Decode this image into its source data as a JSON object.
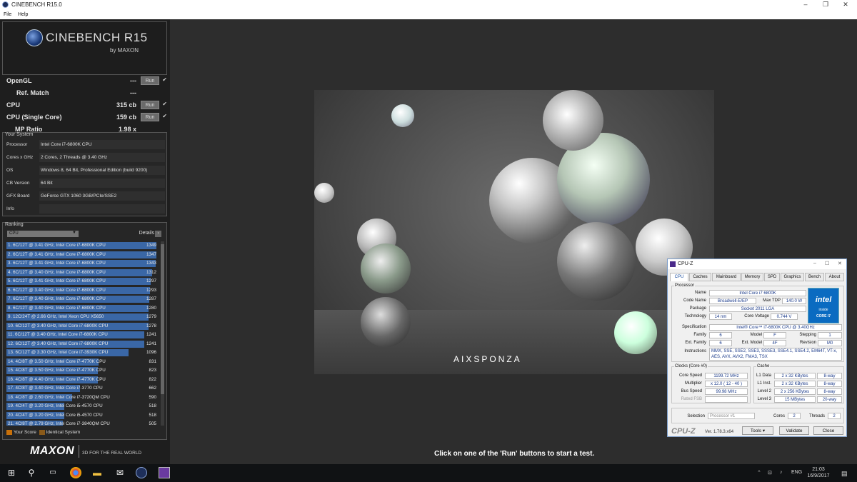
{
  "window": {
    "title": "CINEBENCH R15.0"
  },
  "menu": [
    "File",
    "Help"
  ],
  "logo": {
    "name": "CINEBENCH R15",
    "by": "by MAXON"
  },
  "scores": [
    {
      "label": "OpenGL",
      "value": "---",
      "run": "Run",
      "check": true
    },
    {
      "label": "Ref. Match",
      "value": "---",
      "run": "",
      "check": false
    },
    {
      "label": "CPU",
      "value": "315 cb",
      "run": "Run",
      "check": true
    },
    {
      "label": "CPU (Single Core)",
      "value": "159 cb",
      "run": "Run",
      "check": true
    },
    {
      "label": "MP Ratio",
      "value": "1.98 x",
      "run": "",
      "check": false
    }
  ],
  "system": {
    "title": "Your System",
    "rows": [
      {
        "k": "Processor",
        "v": "Intel Core i7-6800K CPU"
      },
      {
        "k": "Cores x GHz",
        "v": "2 Cores, 2 Threads @ 3.40 GHz"
      },
      {
        "k": "OS",
        "v": "Windows 8, 64 Bit, Professional Edition (build 9200)"
      },
      {
        "k": "CB Version",
        "v": "64 Bit"
      },
      {
        "k": "GFX Board",
        "v": "GeForce GTX 1060 3GB/PCIe/SSE2"
      },
      {
        "k": "Info",
        "v": ""
      }
    ]
  },
  "ranking": {
    "title": "Ranking",
    "dropdown": "CPU",
    "details": "Details",
    "items": [
      {
        "t": "1. 6C/12T @ 3.41 GHz, Intel Core i7-6800K CPU",
        "s": "1349"
      },
      {
        "t": "2. 6C/12T @ 3.41 GHz, Intel Core i7-6800K CPU",
        "s": "1347"
      },
      {
        "t": "3. 6C/12T @ 3.41 GHz, Intel Core i7-6800K CPU",
        "s": "1343"
      },
      {
        "t": "4. 6C/12T @ 3.40 GHz, Intel Core i7-6800K CPU",
        "s": "1312"
      },
      {
        "t": "5. 6C/12T @ 3.41 GHz, Intel Core i7-6800K CPU",
        "s": "1297"
      },
      {
        "t": "6. 6C/12T @ 3.40 GHz, Intel Core i7-6800K CPU",
        "s": "1293"
      },
      {
        "t": "7. 6C/12T @ 3.40 GHz, Intel Core i7-6800K CPU",
        "s": "1287"
      },
      {
        "t": "8. 6C/12T @ 3.40 GHz, Intel Core i7-6800K CPU",
        "s": "1280"
      },
      {
        "t": "9. 12C/24T @ 2.66 GHz, Intel Xeon CPU X5650",
        "s": "1279"
      },
      {
        "t": "10. 6C/12T @ 3.40 GHz, Intel Core i7-6800K CPU",
        "s": "1278"
      },
      {
        "t": "11. 6C/12T @ 3.40 GHz, Intel Core i7-6800K CPU",
        "s": "1241"
      },
      {
        "t": "12. 6C/12T @ 3.40 GHz, Intel Core i7-6800K CPU",
        "s": "1241"
      },
      {
        "t": "13. 6C/12T @ 3.30 GHz,  Intel Core i7-3930K CPU",
        "s": "1096"
      },
      {
        "t": "14. 4C/8T @ 3.50 GHz, Intel Core i7-4770K CPU",
        "s": "831"
      },
      {
        "t": "15. 4C/8T @ 3.50 GHz, Intel Core i7-4770K CPU",
        "s": "823"
      },
      {
        "t": "16. 4C/8T @ 4.40 GHz, Intel Core i7-4770K CPU",
        "s": "822"
      },
      {
        "t": "17. 4C/8T @ 3.40 GHz,  Intel Core i7-3770 CPU",
        "s": "662"
      },
      {
        "t": "18. 4C/8T @ 2.60 GHz, Intel Core i7-3720QM CPU",
        "s": "590"
      },
      {
        "t": "19. 4C/4T @ 3.20 GHz, Intel Core i5-4570 CPU",
        "s": "518"
      },
      {
        "t": "20. 4C/4T @ 3.20 GHz, Intel Core i5-4570 CPU",
        "s": "518"
      },
      {
        "t": "21. 4C/8T @ 2.79 GHz, Intel Core i7-3840QM CPU",
        "s": "505"
      }
    ],
    "legend": {
      "your_score": "Your Score",
      "identical": "Identical System"
    }
  },
  "footer": {
    "brand": "MAXON",
    "tagline": "3D FOR THE REAL WORLD"
  },
  "render": {
    "brand": "AIXSPONZA"
  },
  "status_text": "Click on one of the 'Run' buttons to start a test.",
  "cpuz": {
    "title": "CPU-Z",
    "tabs": [
      "CPU",
      "Caches",
      "Mainboard",
      "Memory",
      "SPD",
      "Graphics",
      "Bench",
      "About"
    ],
    "processor_title": "Processor",
    "name_k": "Name",
    "name": "Intel Core i7 6800K",
    "codename_k": "Code Name",
    "codename": "Broadwell-E/EP",
    "tdp_k": "Max TDP",
    "tdp": "140.0 W",
    "package_k": "Package",
    "package": "Socket 2011 LGA",
    "tech_k": "Technology",
    "tech": "14 nm",
    "voltage_k": "Core Voltage",
    "voltage": "0.744 V",
    "spec_k": "Specification",
    "spec": "Intel® Core™ i7-6800K CPU @ 3.40GHz",
    "family_k": "Family",
    "family": "6",
    "model_k": "Model",
    "model": "F",
    "stepping_k": "Stepping",
    "stepping": "1",
    "extfam_k": "Ext. Family",
    "extfam": "6",
    "extmodel_k": "Ext. Model",
    "extmodel": "4F",
    "revision_k": "Revision",
    "revision": "M0",
    "instr_k": "Instructions",
    "instr": "MMX, SSE, SSE2, SSE3, SSSE3, SSE4.1, SSE4.2, EM64T, VT-x, AES, AVX, AVX2, FMA3, TSX",
    "intel": {
      "logo": "intel",
      "inside": "inside",
      "core": "CORE i7"
    },
    "clocks_title": "Clocks (Core #0)",
    "corespeed_k": "Core Speed",
    "corespeed": "1199.72 MHz",
    "mult_k": "Multiplier",
    "mult": "x 12.0 ( 12 - 40 )",
    "bus_k": "Bus Speed",
    "bus": "99.98 MHz",
    "fsb_k": "Rated FSB",
    "fsb": "",
    "cache_title": "Cache",
    "l1d_k": "L1 Data",
    "l1d": "2 x 32 KBytes",
    "l1d_w": "8-way",
    "l1i_k": "L1 Inst.",
    "l1i": "2 x 32 KBytes",
    "l1i_w": "8-way",
    "l2_k": "Level 2",
    "l2": "2 x 256 KBytes",
    "l2_w": "8-way",
    "l3_k": "Level 3",
    "l3": "15 MBytes",
    "l3_w": "20-way",
    "selection_k": "Selection",
    "selection": "Processor #1",
    "cores_k": "Cores",
    "cores": "2",
    "threads_k": "Threads",
    "threads": "2",
    "logo": "CPU-Z",
    "version": "Ver. 1.78.3.x64",
    "tools": "Tools",
    "validate": "Validate",
    "close": "Close"
  },
  "taskbar": {
    "lang": "ENG",
    "time": "21:03",
    "date": "16/9/2017"
  },
  "colors": {
    "bar": "#3a67a6",
    "your_score": "#c8700a",
    "identical": "#8a5a1a"
  }
}
